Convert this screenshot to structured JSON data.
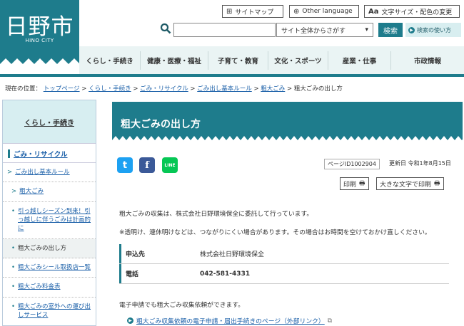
{
  "logo": {
    "title": "日野市",
    "subtitle": "HINO CITY"
  },
  "header": {
    "sitemap": "サイトマップ",
    "language": "Other language",
    "fontsize_icon_text": "Aa",
    "fontsize": "文字サイズ・配色の変更",
    "search_placeholder": "",
    "scope": "サイト全体からさがす",
    "search_button": "検索",
    "howto": "検索の使い方"
  },
  "nav": [
    "くらし・手続き",
    "健康・医療・福祉",
    "子育て・教育",
    "文化・スポーツ",
    "産業・仕事",
    "市政情報"
  ],
  "breadcrumb": {
    "label": "現在の位置：",
    "links": [
      "トップページ",
      "くらし・手続き",
      "ごみ・リサイクル",
      "ごみ出し基本ルール",
      "粗大ごみ"
    ],
    "separator": ">",
    "current": "粗大ごみの出し方"
  },
  "sidebar": {
    "head": "くらし・手続き",
    "section": "ごみ・リサイクル",
    "items": [
      {
        "mark": ">",
        "label": "ごみ出し基本ルール"
      },
      {
        "mark": ">",
        "label": "粗大ごみ"
      },
      {
        "mark": "•",
        "label": "引っ越しシーズン到来！引っ越しに伴うごみは計画的に"
      },
      {
        "mark": "•",
        "label": "粗大ごみの出し方"
      },
      {
        "mark": "•",
        "label": "粗大ごみシール取扱店一覧"
      },
      {
        "mark": "•",
        "label": "粗大ごみ料金表"
      },
      {
        "mark": "•",
        "label": "粗大ごみの室外への運び出しサービス"
      }
    ]
  },
  "page": {
    "title": "粗大ごみの出し方",
    "page_id": "ページID1002904",
    "updated": "更新日 令和1年8月15日",
    "print": "印刷",
    "print_large": "大きな文字で印刷",
    "intro": "粗大ごみの収集は、株式会社日野環境保全に委託して行っています。",
    "note": "※透明け、連休明けなどは、つながりにくい場合があります。その場合はお時間を空けておかけ直しください。",
    "table": [
      {
        "th": "申込先",
        "td": "株式会社日野環境保全"
      },
      {
        "th": "電話",
        "td": "042-581-4331"
      }
    ],
    "online": "電子申請でも粗大ごみ収集依頼ができます。",
    "online_link": "粗大ごみ収集依頼の電子申請・届出手続きのページ（外部リンク）"
  },
  "social": {
    "twitter": "twitter-icon",
    "facebook": "facebook-icon",
    "line": "line-icon",
    "line_text": "LINE"
  },
  "colors": {
    "accent": "#1e7c8c",
    "link": "#1a5fa8",
    "nav_bg": "#eaf4f4"
  }
}
